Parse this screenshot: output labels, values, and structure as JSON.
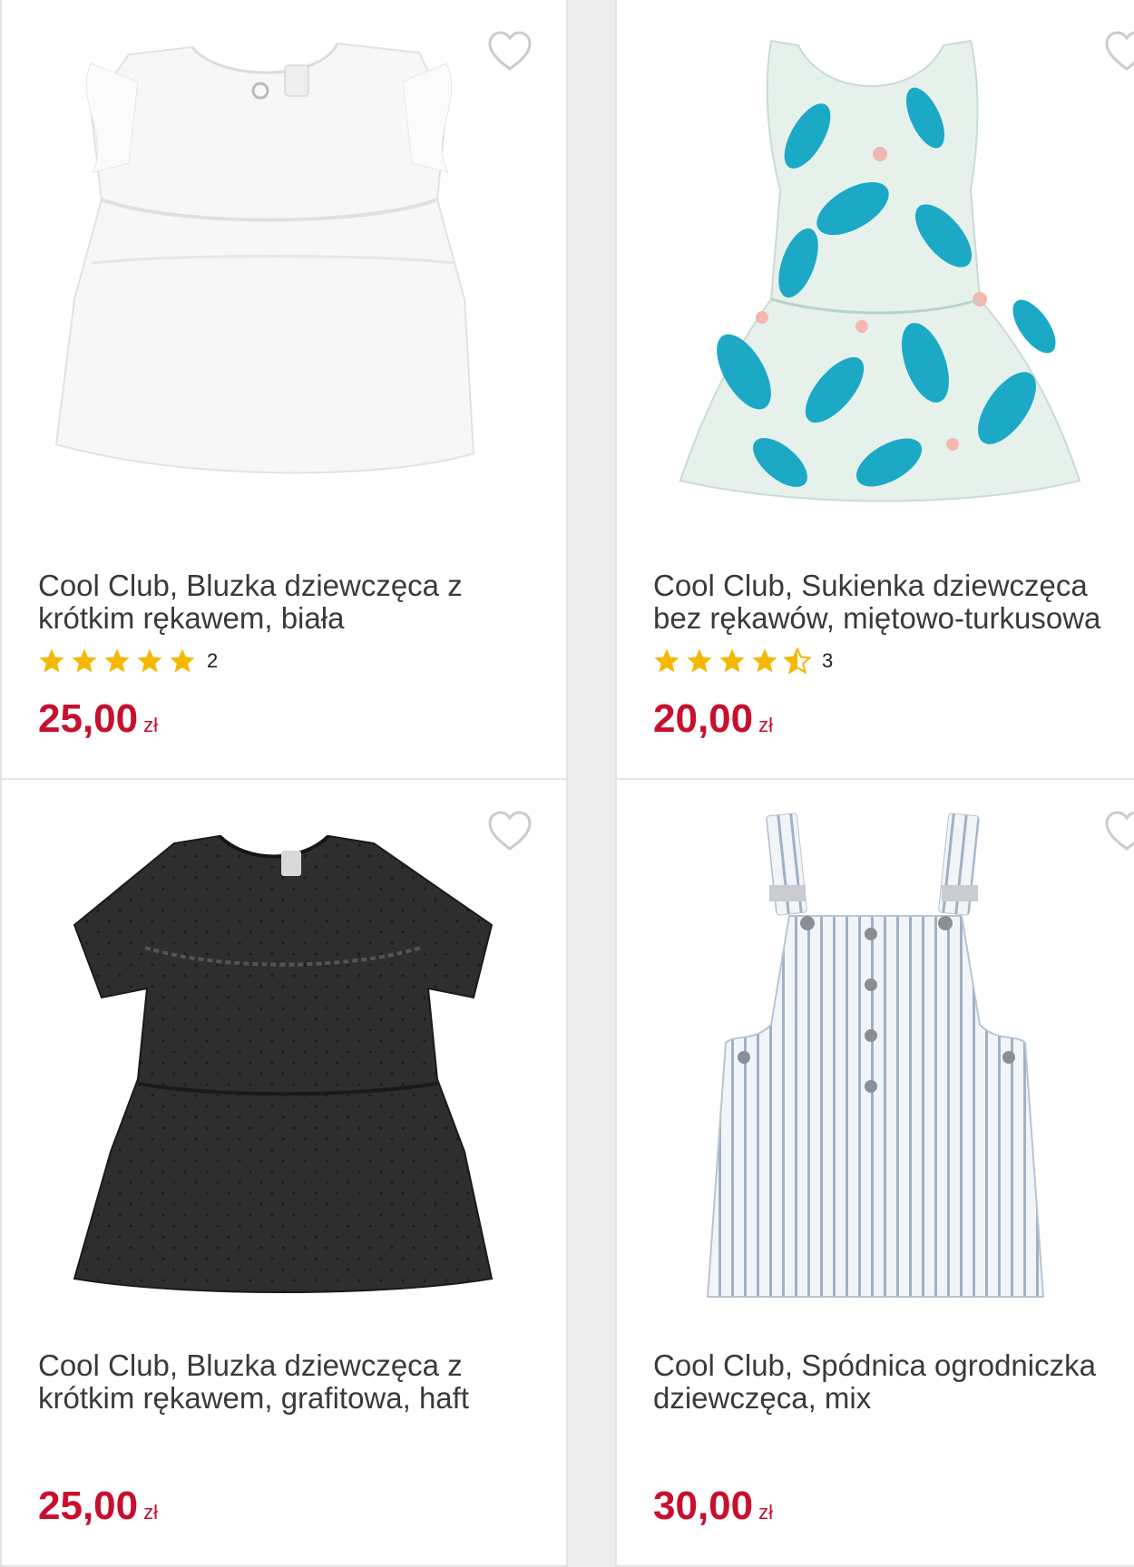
{
  "colors": {
    "price": "#c8102e",
    "star": "#f5b800",
    "heart_outline": "#cccccc"
  },
  "products": [
    {
      "title_line1": "Cool Club, Bluzka dziewczęca z",
      "title_line2": "krótkim rękawem, biała",
      "rating": 5,
      "rating_count": "2",
      "price": "25,00",
      "currency": "zł",
      "image_icon": "white-blouse-image"
    },
    {
      "title_line1": "Cool Club, Sukienka dziewczęca",
      "title_line2": "bez rękawów, miętowo-turkusowa",
      "rating": 4.5,
      "rating_count": "3",
      "price": "20,00",
      "currency": "zł",
      "image_icon": "mint-dress-image"
    },
    {
      "title_line1": "Cool Club, Bluzka dziewczęca z",
      "title_line2": "krótkim rękawem, grafitowa, haft",
      "price": "25,00",
      "currency": "zł",
      "image_icon": "graphite-blouse-image"
    },
    {
      "title_line1": "Cool Club, Spódnica ogrodniczka",
      "title_line2": "dziewczęca, mix",
      "price": "30,00",
      "currency": "zł",
      "image_icon": "striped-pinafore-image"
    }
  ]
}
